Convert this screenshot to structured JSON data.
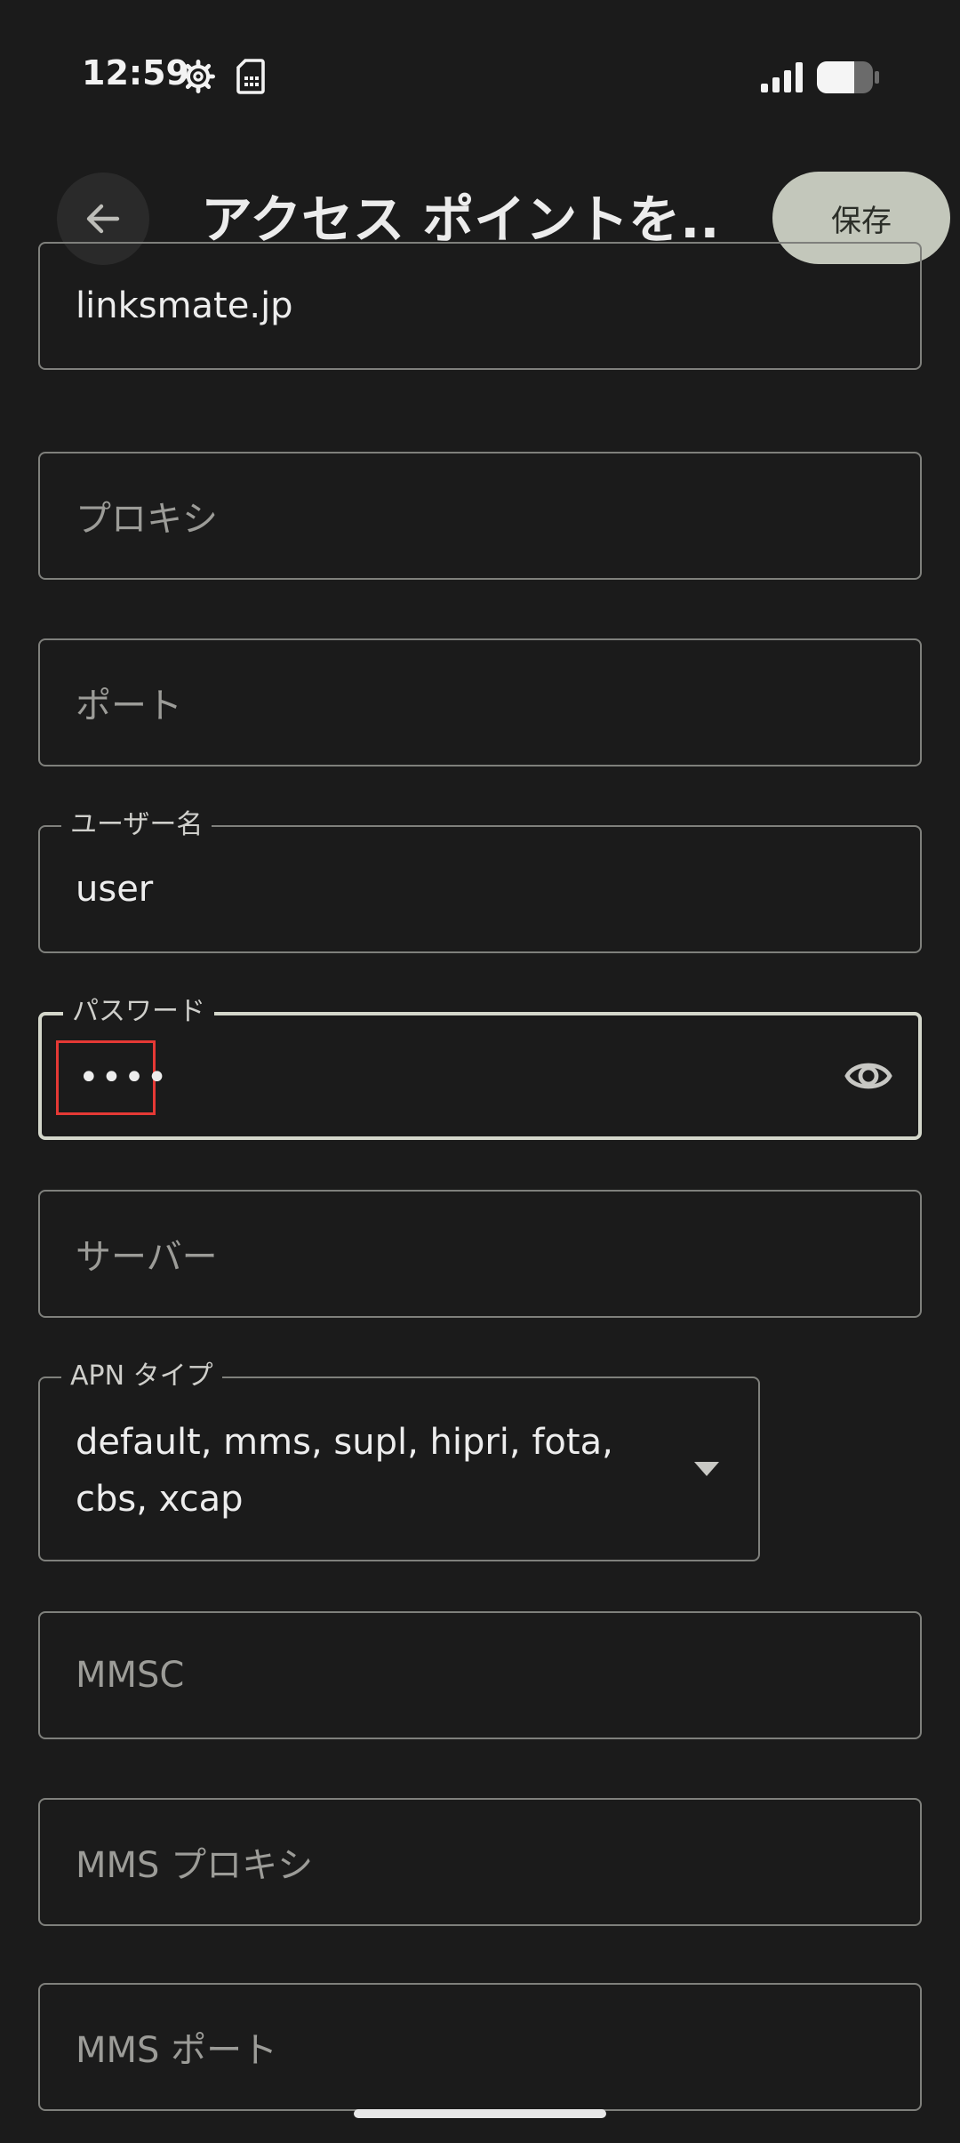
{
  "status_bar": {
    "time": "12:59",
    "icons": [
      "gear-icon",
      "sim-card-icon",
      "signal-icon",
      "battery-icon"
    ]
  },
  "app_bar": {
    "back_icon": "arrow-left-icon",
    "title": "アクセス ポイントを...",
    "save_label": "保存"
  },
  "form": {
    "apn_value": "linksmate.jp",
    "proxy_placeholder": "プロキシ",
    "port_placeholder": "ポート",
    "username_label": "ユーザー名",
    "username_value": "user",
    "password_label": "パスワード",
    "password_value": "••••",
    "password_toggle_icon": "eye-icon",
    "server_placeholder": "サーバー",
    "apn_type_label": "APN タイプ",
    "apn_type_value": "default, mms, supl, hipri, fota, cbs, xcap",
    "mmsc_placeholder": "MMSC",
    "mms_proxy_placeholder": "MMS プロキシ",
    "mms_port_placeholder": "MMS ポート"
  },
  "colors": {
    "background": "#1b1b1b",
    "save_button_bg": "#c3c7bb",
    "focused_border": "#d4d7cb",
    "highlight_box": "#e53935"
  }
}
